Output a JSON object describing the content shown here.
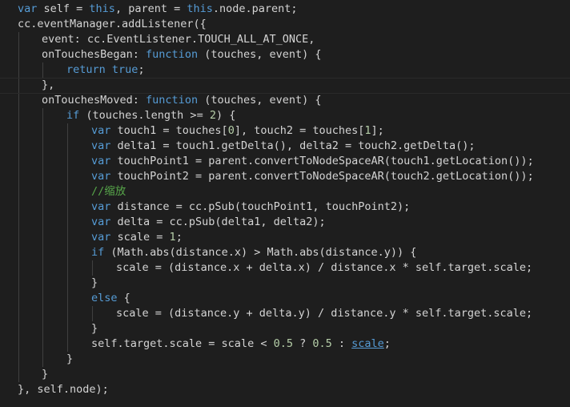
{
  "code_lines": [
    {
      "indent": 1,
      "tokens": [
        {
          "c": "kw",
          "t": "var"
        },
        {
          "c": "id",
          "t": " self = "
        },
        {
          "c": "kw",
          "t": "this"
        },
        {
          "c": "id",
          "t": ", parent = "
        },
        {
          "c": "kw",
          "t": "this"
        },
        {
          "c": "id",
          "t": ".node.parent;"
        }
      ]
    },
    {
      "indent": 1,
      "tokens": [
        {
          "c": "id",
          "t": "cc.eventManager.addListener({"
        }
      ]
    },
    {
      "indent": 2,
      "tokens": [
        {
          "c": "id",
          "t": "event: cc.EventListener.TOUCH_ALL_AT_ONCE,"
        }
      ]
    },
    {
      "indent": 2,
      "tokens": [
        {
          "c": "id",
          "t": "onTouchesBegan: "
        },
        {
          "c": "kw",
          "t": "function"
        },
        {
          "c": "id",
          "t": " (touches, event) {"
        }
      ]
    },
    {
      "indent": 3,
      "tokens": [
        {
          "c": "kw",
          "t": "return"
        },
        {
          "c": "id",
          "t": " "
        },
        {
          "c": "kw",
          "t": "true"
        },
        {
          "c": "id",
          "t": ";"
        }
      ]
    },
    {
      "indent": 2,
      "tokens": [
        {
          "c": "id",
          "t": "},"
        }
      ]
    },
    {
      "indent": 2,
      "tokens": [
        {
          "c": "id",
          "t": "onTouchesMoved: "
        },
        {
          "c": "kw",
          "t": "function"
        },
        {
          "c": "id",
          "t": " (touches, event) {"
        }
      ]
    },
    {
      "indent": 3,
      "tokens": [
        {
          "c": "kw",
          "t": "if"
        },
        {
          "c": "id",
          "t": " (touches.length >= "
        },
        {
          "c": "num",
          "t": "2"
        },
        {
          "c": "id",
          "t": ") {"
        }
      ]
    },
    {
      "indent": 4,
      "tokens": [
        {
          "c": "kw",
          "t": "var"
        },
        {
          "c": "id",
          "t": " touch1 = touches["
        },
        {
          "c": "num",
          "t": "0"
        },
        {
          "c": "id",
          "t": "], touch2 = touches["
        },
        {
          "c": "num",
          "t": "1"
        },
        {
          "c": "id",
          "t": "];"
        }
      ]
    },
    {
      "indent": 4,
      "tokens": [
        {
          "c": "kw",
          "t": "var"
        },
        {
          "c": "id",
          "t": " delta1 = touch1.getDelta(), delta2 = touch2.getDelta();"
        }
      ]
    },
    {
      "indent": 4,
      "tokens": [
        {
          "c": "kw",
          "t": "var"
        },
        {
          "c": "id",
          "t": " touchPoint1 = parent.convertToNodeSpaceAR(touch1.getLocation());"
        }
      ]
    },
    {
      "indent": 4,
      "tokens": [
        {
          "c": "kw",
          "t": "var"
        },
        {
          "c": "id",
          "t": " touchPoint2 = parent.convertToNodeSpaceAR(touch2.getLocation());"
        }
      ]
    },
    {
      "indent": 4,
      "tokens": [
        {
          "c": "cmt",
          "t": "//缩放"
        }
      ]
    },
    {
      "indent": 4,
      "tokens": [
        {
          "c": "kw",
          "t": "var"
        },
        {
          "c": "id",
          "t": " distance = cc.pSub(touchPoint1, touchPoint2);"
        }
      ]
    },
    {
      "indent": 4,
      "tokens": [
        {
          "c": "kw",
          "t": "var"
        },
        {
          "c": "id",
          "t": " delta = cc.pSub(delta1, delta2);"
        }
      ]
    },
    {
      "indent": 4,
      "tokens": [
        {
          "c": "kw",
          "t": "var"
        },
        {
          "c": "id",
          "t": " scale = "
        },
        {
          "c": "num",
          "t": "1"
        },
        {
          "c": "id",
          "t": ";"
        }
      ]
    },
    {
      "indent": 4,
      "tokens": [
        {
          "c": "kw",
          "t": "if"
        },
        {
          "c": "id",
          "t": " (Math.abs(distance.x) > Math.abs(distance.y)) {"
        }
      ]
    },
    {
      "indent": 5,
      "tokens": [
        {
          "c": "id",
          "t": "scale = (distance.x + delta.x) / distance.x * self.target.scale;"
        }
      ]
    },
    {
      "indent": 4,
      "tokens": [
        {
          "c": "id",
          "t": "}"
        }
      ]
    },
    {
      "indent": 4,
      "tokens": [
        {
          "c": "kw",
          "t": "else"
        },
        {
          "c": "id",
          "t": " {"
        }
      ]
    },
    {
      "indent": 5,
      "tokens": [
        {
          "c": "id",
          "t": "scale = (distance.y + delta.y) / distance.y * self.target.scale;"
        }
      ]
    },
    {
      "indent": 4,
      "tokens": [
        {
          "c": "id",
          "t": "}"
        }
      ]
    },
    {
      "indent": 4,
      "tokens": [
        {
          "c": "id",
          "t": "self.target.scale = scale < "
        },
        {
          "c": "num",
          "t": "0.5"
        },
        {
          "c": "id",
          "t": " ? "
        },
        {
          "c": "num",
          "t": "0.5"
        },
        {
          "c": "id",
          "t": " : "
        },
        {
          "c": "lnk",
          "t": "scale"
        },
        {
          "c": "id",
          "t": ";"
        }
      ]
    },
    {
      "indent": 3,
      "tokens": [
        {
          "c": "id",
          "t": "}"
        }
      ]
    },
    {
      "indent": 2,
      "tokens": [
        {
          "c": "id",
          "t": "}"
        }
      ]
    },
    {
      "indent": 1,
      "tokens": [
        {
          "c": "id",
          "t": "}, self.node);"
        }
      ]
    }
  ],
  "colors": {
    "background": "#1e1e1e",
    "keyword": "#569cd6",
    "identifier": "#d4d4d4",
    "number": "#b5cea8",
    "comment": "#57a64a",
    "indent_guide": "#404040"
  }
}
